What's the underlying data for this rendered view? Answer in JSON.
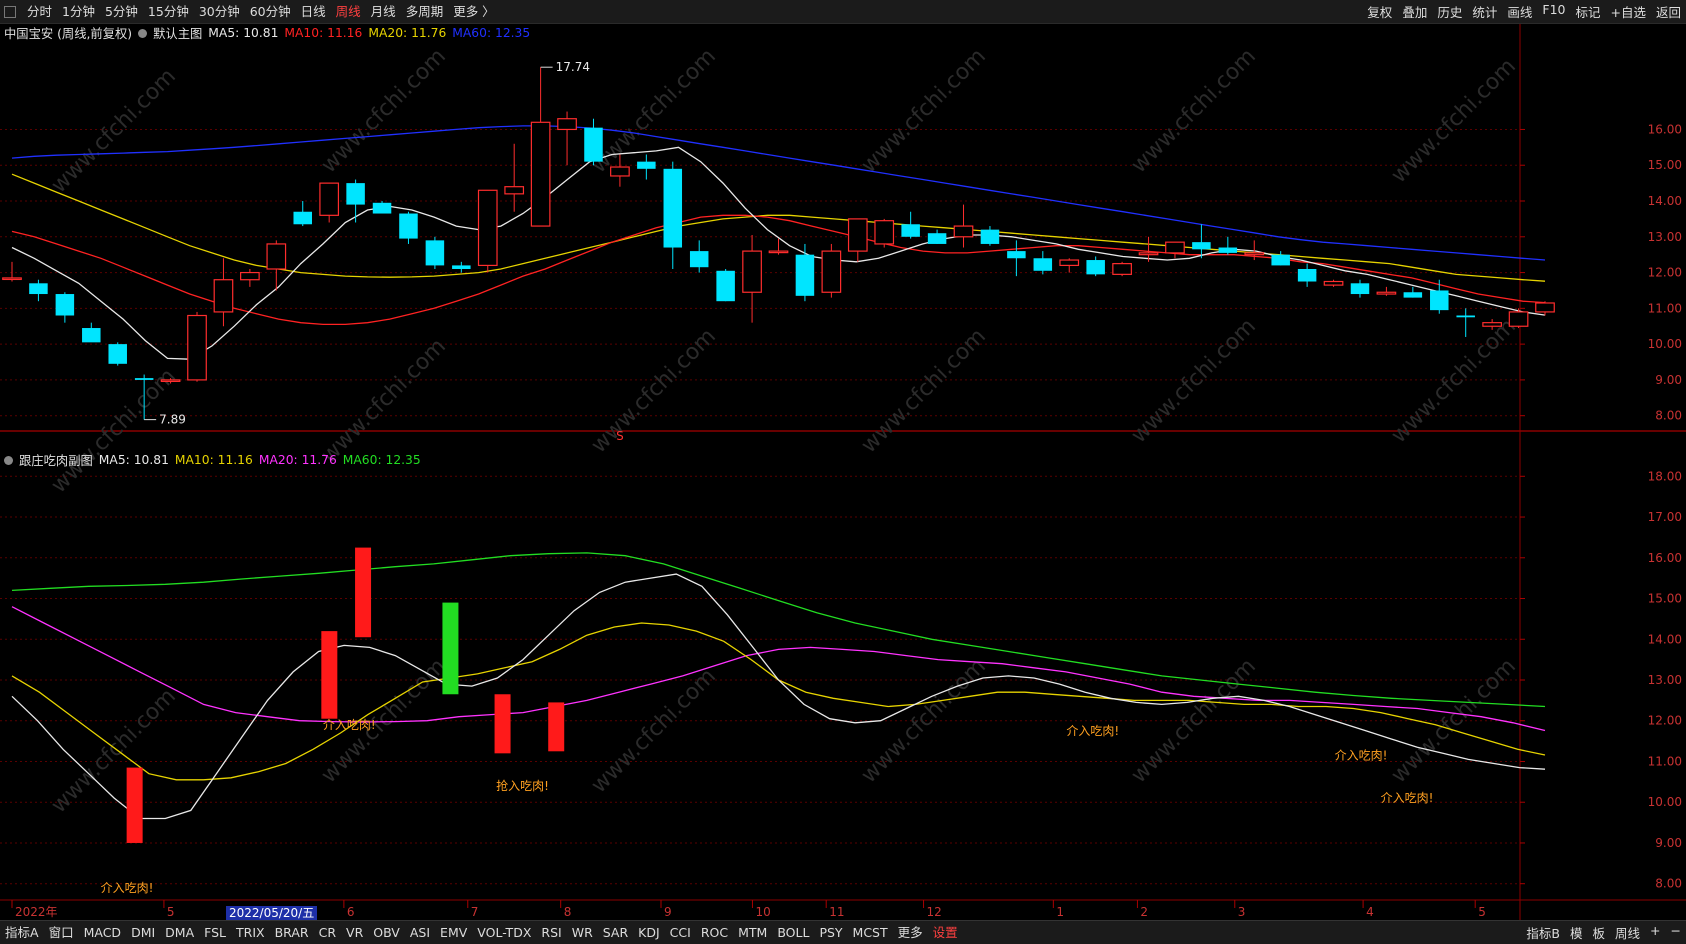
{
  "toolbar": {
    "periods": [
      "分时",
      "1分钟",
      "5分钟",
      "15分钟",
      "30分钟",
      "60分钟",
      "日线",
      "周线",
      "月线",
      "多周期",
      "更多 〉"
    ],
    "active_period": "周线",
    "right_items": [
      "复权",
      "叠加",
      "历史",
      "统计",
      "画线",
      "F10",
      "标记",
      "+自选",
      "返回"
    ]
  },
  "main_legend": {
    "title": "中国宝安 (周线,前复权)",
    "chart_name": "默认主图",
    "ma5": "MA5: 10.81",
    "ma10": "MA10: 11.16",
    "ma20": "MA20: 11.76",
    "ma60": "MA60: 12.35"
  },
  "sub_legend": {
    "chart_name": "跟庄吃肉副图",
    "ma5": "MA5: 10.81",
    "ma10": "MA10: 11.16",
    "ma20": "MA20: 11.76",
    "ma60": "MA60: 12.35"
  },
  "main_labels": {
    "high": "17.74",
    "low": "7.89",
    "marker": "S"
  },
  "sub_labels": {
    "cursor_date": "2022/05/20/五"
  },
  "time_axis": [
    "2022年",
    "5",
    "6",
    "7",
    "8",
    "9",
    "10",
    "11",
    "12",
    "1",
    "2",
    "3",
    "4",
    "5"
  ],
  "bottom_bar": {
    "items": [
      "指标A",
      "窗口",
      "MACD",
      "DMI",
      "DMA",
      "FSL",
      "TRIX",
      "BRAR",
      "CR",
      "VR",
      "OBV",
      "ASI",
      "EMV",
      "VOL-TDX",
      "RSI",
      "WR",
      "SAR",
      "KDJ",
      "CCI",
      "ROC",
      "MTM",
      "BOLL",
      "PSY",
      "MCST",
      "更多",
      "设置"
    ],
    "settings_item": "设置",
    "right_items": [
      "指标B",
      "模",
      "板",
      "周线",
      "+",
      "−"
    ]
  },
  "watermark": "www.cfchi.com",
  "colors": {
    "up": "#ff2d2d",
    "down": "#00e5ff",
    "ma5": "#e8e8e8",
    "ma10": "#ff2222",
    "ma20": "#e6d300",
    "ma60": "#2030ff",
    "sub_ma20": "#ff33ff",
    "sub_ma60": "#22dd22",
    "signal": "#ffa020",
    "bg": "#000000"
  },
  "chart_data": [
    {
      "type": "candlestick",
      "title": "中国宝安 (周线,前复权)",
      "y_ticks": [
        8.0,
        9.0,
        10.0,
        11.0,
        12.0,
        13.0,
        14.0,
        15.0,
        16.0
      ],
      "ylim": [
        7.6,
        18.5
      ],
      "candles": [
        [
          11.85,
          12.3,
          11.75,
          11.85
        ],
        [
          11.7,
          11.8,
          11.2,
          11.4
        ],
        [
          11.4,
          11.45,
          10.6,
          10.8
        ],
        [
          10.45,
          10.6,
          10.1,
          10.05
        ],
        [
          10.0,
          10.05,
          9.4,
          9.45
        ],
        [
          9.05,
          9.15,
          7.89,
          9.0
        ],
        [
          9.0,
          9.05,
          8.9,
          9.0
        ],
        [
          9.0,
          10.9,
          8.95,
          10.8
        ],
        [
          10.9,
          12.4,
          10.5,
          11.8
        ],
        [
          11.8,
          12.1,
          11.6,
          12.0
        ],
        [
          12.1,
          12.9,
          11.5,
          12.8
        ],
        [
          13.7,
          14.0,
          13.3,
          13.35
        ],
        [
          13.6,
          14.0,
          13.4,
          14.5
        ],
        [
          14.5,
          14.6,
          13.4,
          13.9
        ],
        [
          13.95,
          14.0,
          13.7,
          13.65
        ],
        [
          13.65,
          13.7,
          12.8,
          12.95
        ],
        [
          12.9,
          13.0,
          12.1,
          12.2
        ],
        [
          12.2,
          12.3,
          12.0,
          12.1
        ],
        [
          12.2,
          14.0,
          12.0,
          14.3
        ],
        [
          14.2,
          15.6,
          13.7,
          14.4
        ],
        [
          13.3,
          17.74,
          13.3,
          16.2
        ],
        [
          16.0,
          16.5,
          15.0,
          16.3
        ],
        [
          16.05,
          16.3,
          15.0,
          15.1
        ],
        [
          14.7,
          15.3,
          14.4,
          14.95
        ],
        [
          15.1,
          15.3,
          14.6,
          14.9
        ],
        [
          14.9,
          15.1,
          12.1,
          12.7
        ],
        [
          12.6,
          12.9,
          12.0,
          12.15
        ],
        [
          12.05,
          12.1,
          11.2,
          11.2
        ],
        [
          11.45,
          13.05,
          10.6,
          12.6
        ],
        [
          12.6,
          12.95,
          12.5,
          12.6
        ],
        [
          12.5,
          12.8,
          11.2,
          11.35
        ],
        [
          11.45,
          12.8,
          11.3,
          12.6
        ],
        [
          12.6,
          13.4,
          12.3,
          13.5
        ],
        [
          12.8,
          13.5,
          12.7,
          13.45
        ],
        [
          13.35,
          13.7,
          12.95,
          13.0
        ],
        [
          13.1,
          13.2,
          12.8,
          12.8
        ],
        [
          13.0,
          13.9,
          12.7,
          13.3
        ],
        [
          13.2,
          13.3,
          12.75,
          12.8
        ],
        [
          12.6,
          12.9,
          11.9,
          12.4
        ],
        [
          12.4,
          12.6,
          11.95,
          12.05
        ],
        [
          12.2,
          12.4,
          12.0,
          12.35
        ],
        [
          12.35,
          12.45,
          11.9,
          11.95
        ],
        [
          11.95,
          12.3,
          11.9,
          12.25
        ],
        [
          12.5,
          13.0,
          12.3,
          12.55
        ],
        [
          12.55,
          12.8,
          12.4,
          12.85
        ],
        [
          12.85,
          13.35,
          12.4,
          12.65
        ],
        [
          12.7,
          13.0,
          12.5,
          12.55
        ],
        [
          12.5,
          12.9,
          12.35,
          12.55
        ],
        [
          12.5,
          12.6,
          12.2,
          12.2
        ],
        [
          12.1,
          12.25,
          11.6,
          11.75
        ],
        [
          11.65,
          11.8,
          11.6,
          11.75
        ],
        [
          11.7,
          11.8,
          11.3,
          11.4
        ],
        [
          11.4,
          11.6,
          11.35,
          11.45
        ],
        [
          11.45,
          11.6,
          11.3,
          11.3
        ],
        [
          11.5,
          11.8,
          10.85,
          10.95
        ],
        [
          10.8,
          11.0,
          10.2,
          10.75
        ],
        [
          10.5,
          10.7,
          10.4,
          10.6
        ],
        [
          10.5,
          11.0,
          10.45,
          10.9
        ],
        [
          10.9,
          11.2,
          10.8,
          11.15
        ]
      ],
      "ma5": [
        12.7,
        12.4,
        12.05,
        11.7,
        11.2,
        10.7,
        10.1,
        9.6,
        9.58,
        9.95,
        10.5,
        11.1,
        11.6,
        12.25,
        12.8,
        13.4,
        13.75,
        13.85,
        13.75,
        13.55,
        13.3,
        13.2,
        13.3,
        13.65,
        14.1,
        14.6,
        15.1,
        15.3,
        15.35,
        15.4,
        15.5,
        15.1,
        14.5,
        13.8,
        13.2,
        12.75,
        12.45,
        12.35,
        12.3,
        12.4,
        12.6,
        12.8,
        12.95,
        13.05,
        13.05,
        13.0,
        12.9,
        12.8,
        12.65,
        12.55,
        12.45,
        12.4,
        12.35,
        12.4,
        12.55,
        12.65,
        12.6,
        12.45,
        12.35,
        12.2,
        12.05,
        11.95,
        11.8,
        11.65,
        11.5,
        11.35,
        11.2,
        11.05,
        10.9,
        10.81
      ],
      "ma10": [
        13.15,
        13.0,
        12.8,
        12.6,
        12.4,
        12.15,
        11.9,
        11.65,
        11.4,
        11.2,
        11.0,
        10.85,
        10.7,
        10.6,
        10.55,
        10.55,
        10.6,
        10.7,
        10.85,
        11.0,
        11.2,
        11.4,
        11.65,
        11.9,
        12.1,
        12.35,
        12.6,
        12.85,
        13.05,
        13.25,
        13.4,
        13.55,
        13.6,
        13.6,
        13.55,
        13.45,
        13.3,
        13.15,
        13.0,
        12.85,
        12.7,
        12.6,
        12.55,
        12.55,
        12.6,
        12.65,
        12.7,
        12.75,
        12.75,
        12.7,
        12.65,
        12.6,
        12.55,
        12.5,
        12.5,
        12.5,
        12.45,
        12.4,
        12.3,
        12.25,
        12.15,
        12.05,
        11.95,
        11.85,
        11.7,
        11.55,
        11.4,
        11.3,
        11.2,
        11.16
      ],
      "ma20": [
        14.75,
        14.5,
        14.25,
        14.0,
        13.75,
        13.5,
        13.25,
        13.0,
        12.75,
        12.55,
        12.35,
        12.2,
        12.1,
        12.0,
        11.95,
        11.9,
        11.88,
        11.87,
        11.88,
        11.9,
        11.95,
        12.0,
        12.1,
        12.25,
        12.4,
        12.55,
        12.7,
        12.85,
        13.0,
        13.15,
        13.3,
        13.4,
        13.5,
        13.55,
        13.6,
        13.6,
        13.55,
        13.5,
        13.45,
        13.4,
        13.35,
        13.3,
        13.25,
        13.2,
        13.15,
        13.1,
        13.05,
        13.0,
        12.95,
        12.9,
        12.85,
        12.8,
        12.75,
        12.7,
        12.65,
        12.6,
        12.55,
        12.5,
        12.45,
        12.4,
        12.35,
        12.3,
        12.25,
        12.15,
        12.05,
        11.95,
        11.9,
        11.85,
        11.8,
        11.76
      ],
      "ma60": [
        15.2,
        15.25,
        15.28,
        15.3,
        15.32,
        15.34,
        15.36,
        15.38,
        15.42,
        15.46,
        15.5,
        15.55,
        15.6,
        15.65,
        15.7,
        15.75,
        15.8,
        15.85,
        15.9,
        15.95,
        16.0,
        16.05,
        16.08,
        16.1,
        16.1,
        16.08,
        16.04,
        15.98,
        15.9,
        15.8,
        15.7,
        15.6,
        15.5,
        15.4,
        15.3,
        15.2,
        15.1,
        15.0,
        14.9,
        14.8,
        14.7,
        14.6,
        14.5,
        14.4,
        14.3,
        14.2,
        14.1,
        14.0,
        13.9,
        13.8,
        13.7,
        13.6,
        13.5,
        13.4,
        13.3,
        13.2,
        13.1,
        13.0,
        12.92,
        12.85,
        12.8,
        12.75,
        12.7,
        12.65,
        12.6,
        12.55,
        12.5,
        12.45,
        12.4,
        12.35
      ]
    },
    {
      "type": "indicator",
      "title": "跟庄吃肉副图",
      "y_ticks": [
        8.0,
        9.0,
        10.0,
        11.0,
        12.0,
        13.0,
        14.0,
        15.0,
        16.0,
        17.0,
        18.0
      ],
      "ylim": [
        7.6,
        18.4
      ],
      "ma5": [
        12.6,
        12.0,
        11.3,
        10.7,
        10.1,
        9.6,
        9.6,
        9.8,
        10.7,
        11.6,
        12.5,
        13.2,
        13.7,
        13.85,
        13.8,
        13.6,
        13.25,
        12.9,
        12.85,
        13.05,
        13.5,
        14.1,
        14.7,
        15.15,
        15.4,
        15.5,
        15.6,
        15.3,
        14.6,
        13.8,
        13.0,
        12.4,
        12.05,
        11.95,
        12.0,
        12.3,
        12.6,
        12.85,
        13.05,
        13.1,
        13.05,
        12.9,
        12.7,
        12.55,
        12.45,
        12.4,
        12.45,
        12.55,
        12.6,
        12.5,
        12.35,
        12.15,
        11.95,
        11.75,
        11.55,
        11.35,
        11.2,
        11.05,
        10.95,
        10.85,
        10.81
      ],
      "ma10": [
        13.1,
        12.7,
        12.2,
        11.7,
        11.2,
        10.7,
        10.55,
        10.55,
        10.6,
        10.75,
        10.95,
        11.3,
        11.7,
        12.15,
        12.55,
        12.95,
        13.05,
        13.15,
        13.3,
        13.45,
        13.75,
        14.1,
        14.3,
        14.4,
        14.35,
        14.2,
        13.95,
        13.5,
        13.0,
        12.7,
        12.55,
        12.45,
        12.35,
        12.4,
        12.5,
        12.6,
        12.7,
        12.7,
        12.65,
        12.6,
        12.55,
        12.5,
        12.5,
        12.5,
        12.45,
        12.4,
        12.4,
        12.35,
        12.35,
        12.3,
        12.2,
        12.05,
        11.9,
        11.7,
        11.5,
        11.3,
        11.16
      ],
      "ma20": [
        14.8,
        14.4,
        14.0,
        13.6,
        13.2,
        12.8,
        12.4,
        12.2,
        12.1,
        12.0,
        11.98,
        11.97,
        11.98,
        12.0,
        12.1,
        12.15,
        12.2,
        12.35,
        12.5,
        12.7,
        12.9,
        13.1,
        13.35,
        13.6,
        13.75,
        13.8,
        13.75,
        13.7,
        13.6,
        13.5,
        13.45,
        13.4,
        13.3,
        13.2,
        13.05,
        12.9,
        12.7,
        12.6,
        12.55,
        12.5,
        12.5,
        12.45,
        12.4,
        12.35,
        12.3,
        12.2,
        12.1,
        11.95,
        11.76
      ],
      "ma60": [
        15.2,
        15.25,
        15.3,
        15.32,
        15.35,
        15.4,
        15.48,
        15.55,
        15.62,
        15.7,
        15.78,
        15.85,
        15.95,
        16.05,
        16.1,
        16.12,
        16.05,
        15.85,
        15.55,
        15.25,
        14.95,
        14.65,
        14.4,
        14.2,
        14.0,
        13.85,
        13.7,
        13.55,
        13.4,
        13.25,
        13.1,
        13.0,
        12.9,
        12.8,
        12.7,
        12.62,
        12.55,
        12.5,
        12.45,
        12.4,
        12.35
      ],
      "bars": [
        {
          "x": 0.08,
          "top": 10.85,
          "bottom": 9.0,
          "color": "red"
        },
        {
          "x": 0.207,
          "top": 14.2,
          "bottom": 12.05,
          "color": "red"
        },
        {
          "x": 0.229,
          "top": 16.25,
          "bottom": 14.05,
          "color": "red"
        },
        {
          "x": 0.286,
          "top": 14.9,
          "bottom": 12.65,
          "color": "green"
        },
        {
          "x": 0.32,
          "top": 12.65,
          "bottom": 11.2,
          "color": "red"
        },
        {
          "x": 0.355,
          "top": 12.45,
          "bottom": 11.25,
          "color": "red"
        }
      ],
      "signals": [
        {
          "x": 0.075,
          "y": 7.8,
          "text": "介入吃肉!"
        },
        {
          "x": 0.22,
          "y": 11.8,
          "text": "介入吃肉!"
        },
        {
          "x": 0.333,
          "y": 10.3,
          "text": "抢入吃肉!"
        },
        {
          "x": 0.705,
          "y": 11.65,
          "text": "介入吃肉!"
        },
        {
          "x": 0.88,
          "y": 11.05,
          "text": "介入吃肉!"
        },
        {
          "x": 0.91,
          "y": 10.0,
          "text": "介入吃肉!"
        }
      ]
    }
  ]
}
